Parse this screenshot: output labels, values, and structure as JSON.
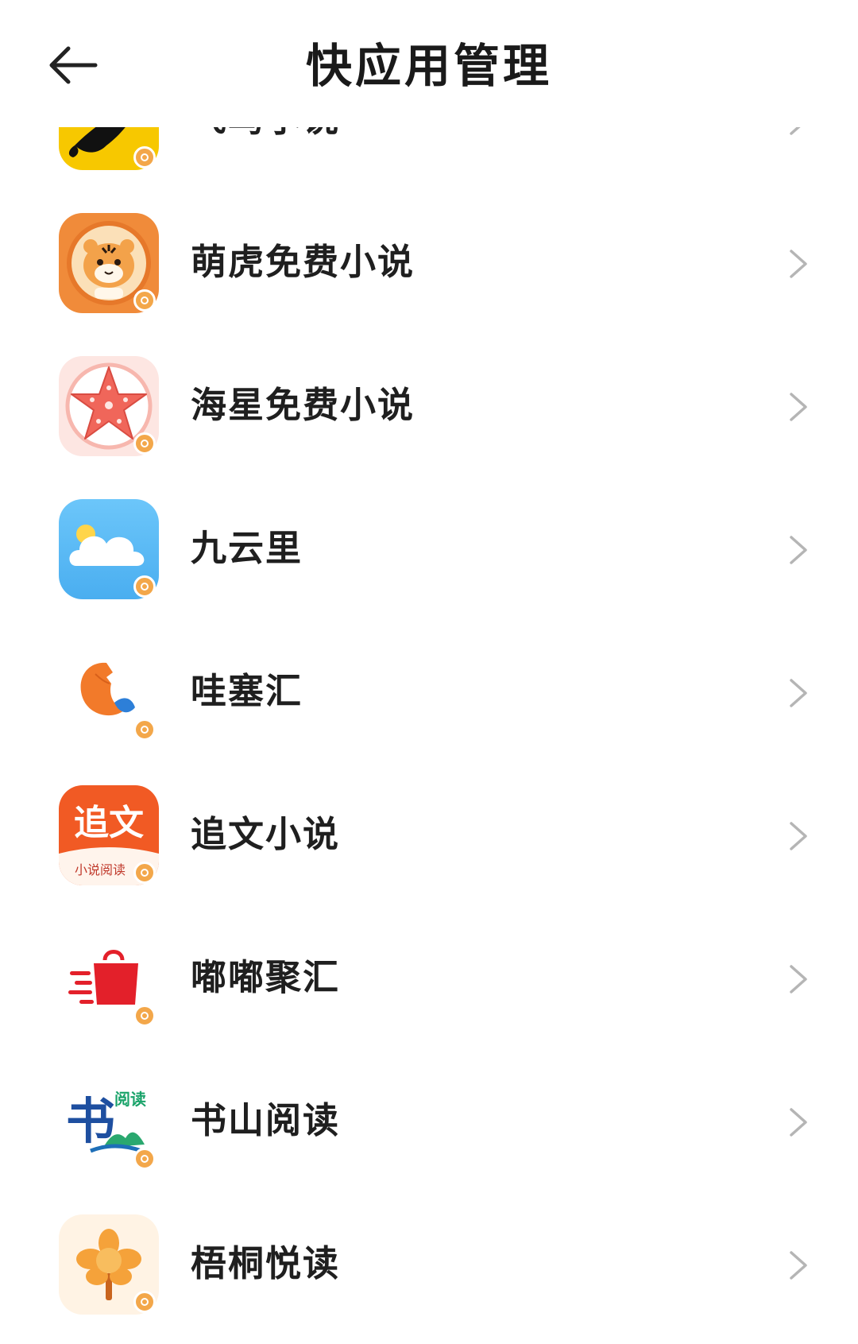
{
  "header": {
    "title": "快应用管理",
    "back_icon": "arrow-left-icon"
  },
  "apps": [
    {
      "name": "飞鸟小说",
      "icon": "bird-icon",
      "color": "#f7c800"
    },
    {
      "name": "萌虎免费小说",
      "icon": "tiger-icon",
      "color": "#f08b3a"
    },
    {
      "name": "海星免费小说",
      "icon": "starfish-icon",
      "color": "#f26a5e"
    },
    {
      "name": "九云里",
      "icon": "cloud-icon",
      "color": "#5bbcf5"
    },
    {
      "name": "哇塞汇",
      "icon": "orange-slice-icon",
      "color": "#f27a2a"
    },
    {
      "name": "追文小说",
      "icon": "zhuiwen-logo-icon",
      "color": "#f15a24"
    },
    {
      "name": "嘟嘟聚汇",
      "icon": "shopping-bag-icon",
      "color": "#e3202a"
    },
    {
      "name": "书山阅读",
      "icon": "shushan-logo-icon",
      "color": "#1e5aa8"
    },
    {
      "name": "梧桐悦读",
      "icon": "flower-tree-icon",
      "color": "#f5a23a"
    }
  ],
  "zhuiwen_icon_text": {
    "main": "追文",
    "sub": "小说阅读"
  },
  "shushan_icon_text": {
    "main": "书",
    "sub": "阅读"
  },
  "row_chevron_icon": "chevron-right-icon"
}
